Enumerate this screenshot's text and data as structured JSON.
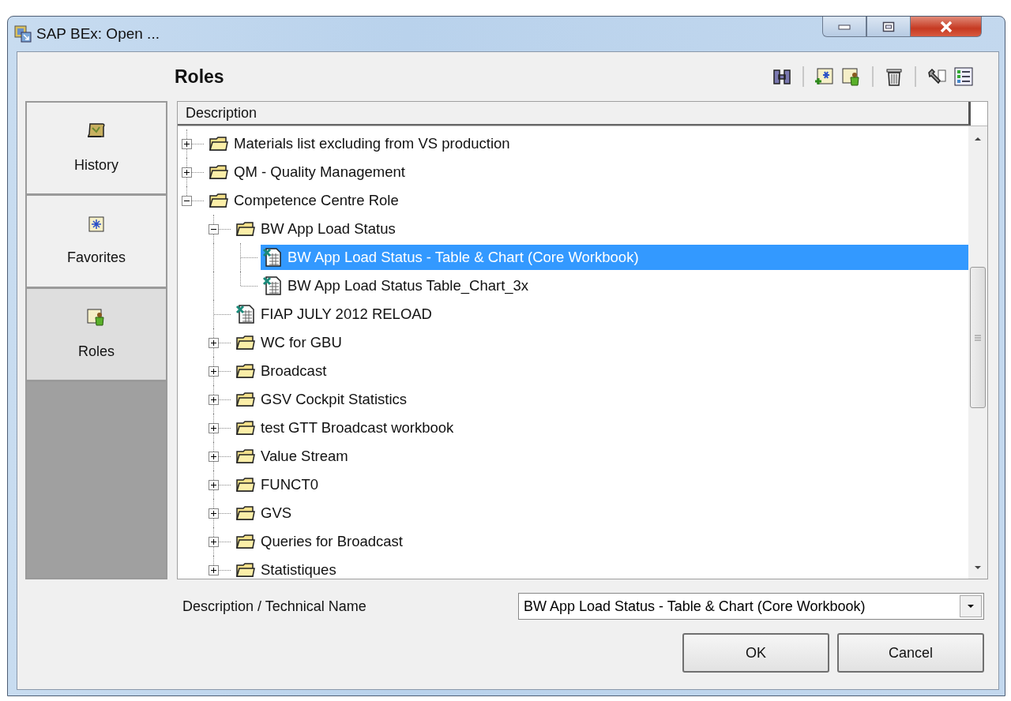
{
  "window": {
    "title": "SAP BEx: Open ..."
  },
  "header": {
    "title": "Roles"
  },
  "sidebar": {
    "items": [
      {
        "label": "History",
        "kind": "history",
        "selected": false
      },
      {
        "label": "Favorites",
        "kind": "favorites",
        "selected": false
      },
      {
        "label": "Roles",
        "kind": "roles",
        "selected": true
      }
    ]
  },
  "tree": {
    "column": "Description",
    "items": [
      {
        "label": "Materials list excluding from VS production",
        "kind": "folder",
        "expanded": false,
        "selected": false
      },
      {
        "label": "QM - Quality Management",
        "kind": "folder",
        "expanded": false,
        "selected": false
      },
      {
        "label": "Competence Centre Role",
        "kind": "folder",
        "expanded": true,
        "selected": false,
        "children": [
          {
            "label": "BW App Load Status",
            "kind": "folder",
            "expanded": true,
            "selected": false,
            "children": [
              {
                "label": "BW App Load Status - Table & Chart (Core Workbook)",
                "kind": "workbook",
                "selected": true
              },
              {
                "label": "BW App Load Status Table_Chart_3x",
                "kind": "workbook",
                "selected": false
              }
            ]
          },
          {
            "label": "FIAP JULY 2012 RELOAD",
            "kind": "workbook",
            "selected": false
          },
          {
            "label": "WC for GBU",
            "kind": "folder",
            "expanded": false,
            "selected": false
          },
          {
            "label": "Broadcast",
            "kind": "folder",
            "expanded": false,
            "selected": false
          },
          {
            "label": "GSV Cockpit Statistics",
            "kind": "folder",
            "expanded": false,
            "selected": false
          },
          {
            "label": "test GTT Broadcast workbook",
            "kind": "folder",
            "expanded": false,
            "selected": false
          },
          {
            "label": "Value Stream",
            "kind": "folder",
            "expanded": false,
            "selected": false
          },
          {
            "label": "FUNCT0",
            "kind": "folder",
            "expanded": false,
            "selected": false
          },
          {
            "label": "GVS",
            "kind": "folder",
            "expanded": false,
            "selected": false
          },
          {
            "label": "Queries for Broadcast",
            "kind": "folder",
            "expanded": false,
            "selected": false
          },
          {
            "label": "Statistiques",
            "kind": "folder",
            "expanded": false,
            "selected": false
          }
        ]
      }
    ]
  },
  "bottom": {
    "field_label": "Description / Technical Name",
    "value": "BW App Load Status - Table & Chart (Core Workbook)"
  },
  "buttons": [
    "OK",
    "Cancel"
  ]
}
